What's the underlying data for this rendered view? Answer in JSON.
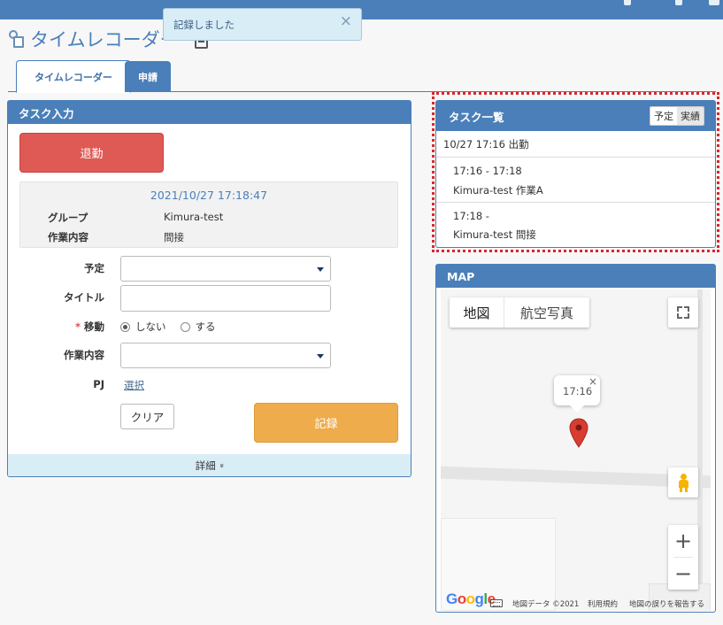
{
  "toast": {
    "message": "記録しました",
    "close": "×"
  },
  "page": {
    "title": "タイムレコーダー"
  },
  "tabs": [
    {
      "label": "タイムレコーダー",
      "active": true
    },
    {
      "label": "申請",
      "active": false
    }
  ],
  "task_input": {
    "header": "タスク入力",
    "leave_button": "退勤",
    "current_datetime": "2021/10/27 17:18:47",
    "group_label": "グループ",
    "group_value": "Kimura-test",
    "work_label": "作業内容",
    "work_value": "間接",
    "form": {
      "schedule_label": "予定",
      "schedule_value": "",
      "title_label": "タイトル",
      "title_value": "",
      "move_required_mark": "*",
      "move_label": "移動",
      "move_options": [
        "しない",
        "する"
      ],
      "move_selected": "しない",
      "work_label": "作業内容",
      "work_value": "",
      "pj_label": "PJ",
      "pj_link": "選択"
    },
    "clear_button": "クリア",
    "record_button": "記録",
    "detail_toggle": "詳細",
    "detail_chevron": "»"
  },
  "task_list": {
    "header": "タスク一覧",
    "toggle": [
      "予定",
      "実績"
    ],
    "toggle_selected": "実績",
    "rows": [
      {
        "line1": "10/27 17:16 出勤",
        "line2": ""
      },
      {
        "line1": "17:16 - 17:18",
        "line2": "Kimura-test 作業A"
      },
      {
        "line1": "17:18 -",
        "line2": "Kimura-test 間接"
      }
    ]
  },
  "map": {
    "header": "MAP",
    "type_buttons": [
      "地図",
      "航空写真"
    ],
    "marker_label": "17:16",
    "marker_close": "×",
    "zoom_in": "+",
    "zoom_out": "−",
    "logo": "Google",
    "attribution": [
      "地図データ ©2021",
      "利用規約",
      "地図の誤りを報告する"
    ]
  },
  "colors": {
    "primary": "#4a7fb9",
    "leave_button": "#df5a54",
    "record_button": "#efac4c",
    "highlight_border": "#d9262d",
    "marker": "#d93c30"
  }
}
